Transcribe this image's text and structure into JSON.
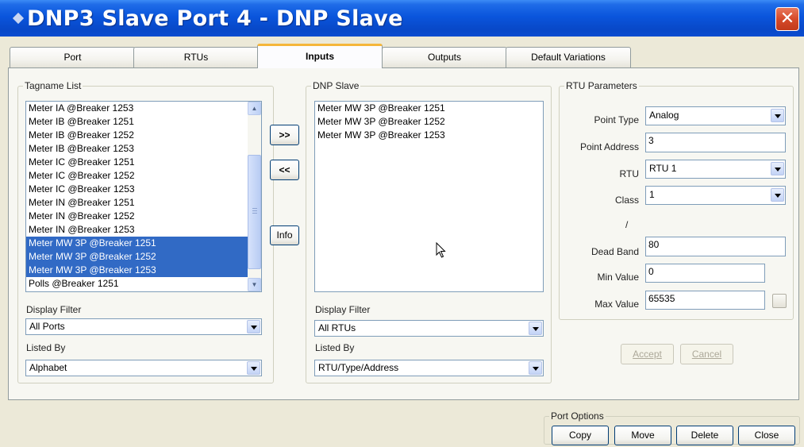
{
  "window": {
    "title": "DNP3 Slave Port 4 - DNP Slave",
    "close_glyph": "✕"
  },
  "tabs": [
    {
      "label": "Port"
    },
    {
      "label": "RTUs"
    },
    {
      "label": "Inputs",
      "active": true
    },
    {
      "label": "Outputs"
    },
    {
      "label": "Default Variations"
    }
  ],
  "tagname_list": {
    "title": "Tagname List",
    "items": [
      {
        "label": "Meter IA @Breaker 1253",
        "selected": false
      },
      {
        "label": "Meter IB @Breaker 1251",
        "selected": false
      },
      {
        "label": "Meter IB @Breaker 1252",
        "selected": false
      },
      {
        "label": "Meter IB @Breaker 1253",
        "selected": false
      },
      {
        "label": "Meter IC @Breaker 1251",
        "selected": false
      },
      {
        "label": "Meter IC @Breaker 1252",
        "selected": false
      },
      {
        "label": "Meter IC @Breaker 1253",
        "selected": false
      },
      {
        "label": "Meter IN @Breaker 1251",
        "selected": false
      },
      {
        "label": "Meter IN @Breaker 1252",
        "selected": false
      },
      {
        "label": "Meter IN @Breaker 1253",
        "selected": false
      },
      {
        "label": "Meter MW 3P @Breaker 1251",
        "selected": true
      },
      {
        "label": "Meter MW 3P @Breaker 1252",
        "selected": true
      },
      {
        "label": "Meter MW 3P @Breaker 1253",
        "selected": true
      },
      {
        "label": "Polls @Breaker 1251",
        "selected": false
      }
    ],
    "display_filter_label": "Display Filter",
    "display_filter_value": "All Ports",
    "listed_by_label": "Listed By",
    "listed_by_value": "Alphabet"
  },
  "transfer": {
    "add_label": ">>",
    "remove_label": "<<",
    "info_label": "Info"
  },
  "dnp_slave": {
    "title": "DNP Slave",
    "items": [
      {
        "label": "Meter MW 3P @Breaker 1251"
      },
      {
        "label": "Meter MW 3P @Breaker 1252"
      },
      {
        "label": "Meter MW 3P @Breaker 1253"
      }
    ],
    "display_filter_label": "Display Filter",
    "display_filter_value": "All RTUs",
    "listed_by_label": "Listed By",
    "listed_by_value": "RTU/Type/Address"
  },
  "rtu_parameters": {
    "title": "RTU Parameters",
    "point_type_label": "Point Type",
    "point_type_value": "Analog",
    "point_address_label": "Point Address",
    "point_address_value": "3",
    "rtu_label": "RTU",
    "rtu_value": "RTU 1",
    "class_label": "Class",
    "class_value": "1",
    "slash": "/",
    "dead_band_label": "Dead Band",
    "dead_band_value": "80",
    "min_value_label": "Min Value",
    "min_value_value": "0",
    "max_value_label": "Max Value",
    "max_value_value": "65535",
    "accept_label": "Accept",
    "cancel_label": "Cancel"
  },
  "port_options": {
    "title": "Port Options",
    "copy_label": "Copy",
    "move_label": "Move",
    "delete_label": "Delete",
    "close_label": "Close"
  },
  "colors": {
    "title_bar": "#0a55dc",
    "selection": "#316ac5",
    "tab_highlight": "#f5b63a",
    "close_button": "#d64a2a"
  }
}
